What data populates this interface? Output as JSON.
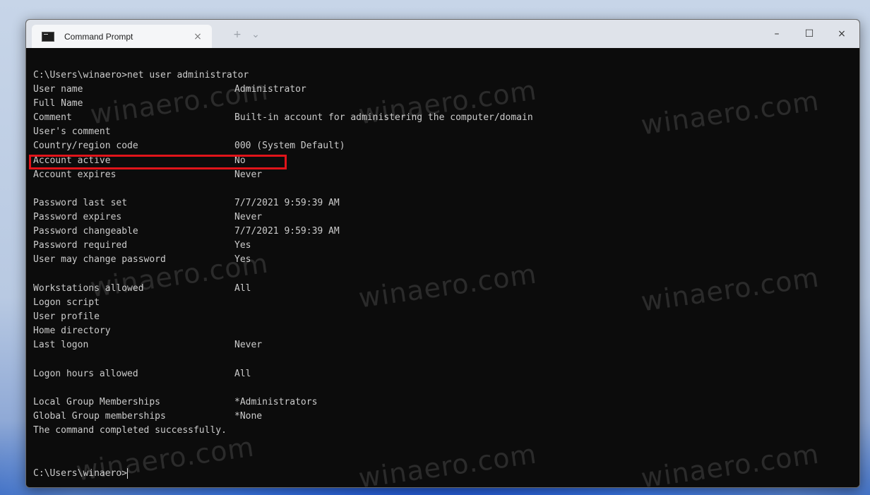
{
  "window": {
    "tab_title": "Command Prompt",
    "tab_close": "×",
    "new_tab": "+",
    "dropdown": "⌄",
    "minimize": "–",
    "maximize": "☐",
    "close": "×"
  },
  "console": {
    "command": "C:\\Users\\winaero>net user administrator",
    "rows": [
      {
        "key": "User name",
        "value": "Administrator"
      },
      {
        "key": "Full Name",
        "value": ""
      },
      {
        "key": "Comment",
        "value": "Built-in account for administering the computer/domain"
      },
      {
        "key": "User's comment",
        "value": ""
      },
      {
        "key": "Country/region code",
        "value": "000 (System Default)"
      },
      {
        "key": "Account active",
        "value": "No"
      },
      {
        "key": "Account expires",
        "value": "Never"
      },
      {
        "key": "Password last set",
        "value": "7/7/2021 9:59:39 AM"
      },
      {
        "key": "Password expires",
        "value": "Never"
      },
      {
        "key": "Password changeable",
        "value": "7/7/2021 9:59:39 AM"
      },
      {
        "key": "Password required",
        "value": "Yes"
      },
      {
        "key": "User may change password",
        "value": "Yes"
      },
      {
        "key": "Workstations allowed",
        "value": "All"
      },
      {
        "key": "Logon script",
        "value": ""
      },
      {
        "key": "User profile",
        "value": ""
      },
      {
        "key": "Home directory",
        "value": ""
      },
      {
        "key": "Last logon",
        "value": "Never"
      },
      {
        "key": "Logon hours allowed",
        "value": "All"
      },
      {
        "key": "Local Group Memberships",
        "value": "*Administrators"
      },
      {
        "key": "Global Group memberships",
        "value": "*None"
      }
    ],
    "completion": "The command completed successfully.",
    "prompt": "C:\\Users\\winaero>"
  },
  "watermark": "winaero.com",
  "colors": {
    "highlight": "#e0141a",
    "console_bg": "#0c0c0c",
    "console_fg": "#cccccc"
  }
}
